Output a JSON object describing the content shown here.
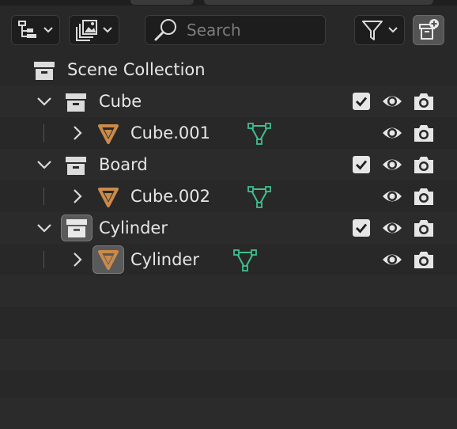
{
  "header": {
    "search_placeholder": "Search"
  },
  "outliner": {
    "root": {
      "label": "Scene Collection"
    },
    "rows": [
      {
        "label": "Cube",
        "kind": "collection",
        "expanded": true,
        "checked": true
      },
      {
        "label": "Cube.001",
        "kind": "mesh-object",
        "expanded": false
      },
      {
        "label": "Board",
        "kind": "collection",
        "expanded": true,
        "checked": true
      },
      {
        "label": "Cube.002",
        "kind": "mesh-object",
        "expanded": false
      },
      {
        "label": "Cylinder",
        "kind": "collection",
        "expanded": true,
        "checked": true,
        "active": true
      },
      {
        "label": "Cylinder",
        "kind": "mesh-object",
        "expanded": false,
        "active": true
      }
    ]
  },
  "colors": {
    "background": "#282828",
    "object_orange": "#c98a4b",
    "mesh_green": "#3fbf8f",
    "icon_light": "#dcdcdc"
  }
}
